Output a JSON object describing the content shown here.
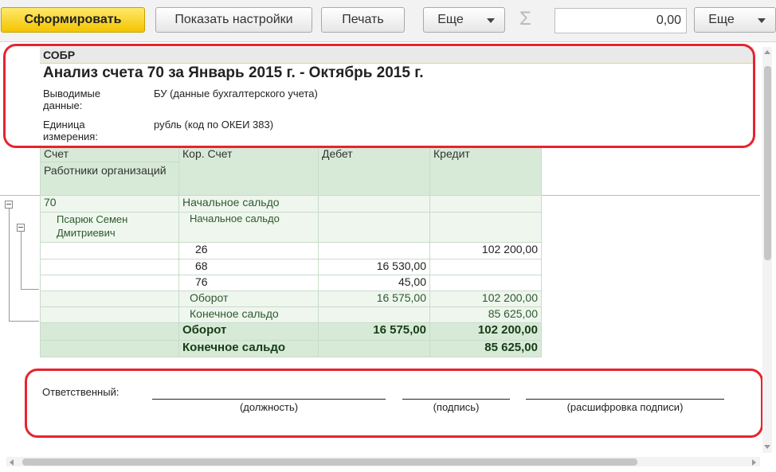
{
  "toolbar": {
    "generate_label": "Сформировать",
    "show_settings_label": "Показать настройки",
    "print_label": "Печать",
    "more_label": "Еще",
    "sum_value": "0,00",
    "more2_label": "Еще"
  },
  "report": {
    "organization": "СОБР",
    "title": "Анализ счета 70 за Январь 2015 г. - Октябрь 2015 г.",
    "params": [
      {
        "label": "Выводимые данные:",
        "value": "БУ (данные бухгалтерского учета)"
      },
      {
        "label": "Единица измерения:",
        "value": "рубль (код по ОКЕИ 383)"
      }
    ],
    "columns": {
      "account": "Счет",
      "account_sub": "Работники организаций",
      "corr_account": "Кор. Счет",
      "debit": "Дебет",
      "credit": "Кредит"
    },
    "rows": [
      {
        "account": "70",
        "corr": "Начальное сальдо",
        "debit": "",
        "credit": ""
      },
      {
        "account": "Псарюк Семен Дмитриевич",
        "corr": "Начальное сальдо",
        "debit": "",
        "credit": ""
      },
      {
        "account": "",
        "corr": "26",
        "debit": "",
        "credit": "102 200,00"
      },
      {
        "account": "",
        "corr": "68",
        "debit": "16 530,00",
        "credit": ""
      },
      {
        "account": "",
        "corr": "76",
        "debit": "45,00",
        "credit": ""
      },
      {
        "account": "",
        "corr": "Оборот",
        "debit": "16 575,00",
        "credit": "102 200,00"
      },
      {
        "account": "",
        "corr": "Конечное сальдо",
        "debit": "",
        "credit": "85 625,00"
      },
      {
        "account": "",
        "corr": "Оборот",
        "debit": "16 575,00",
        "credit": "102 200,00"
      },
      {
        "account": "",
        "corr": "Конечное сальдо",
        "debit": "",
        "credit": "85 625,00"
      }
    ],
    "signature": {
      "label": "Ответственный:",
      "position": "(должность)",
      "sign": "(подпись)",
      "decode": "(расшифровка подписи)"
    }
  },
  "colors": {
    "accent_yellow": "#f3c400",
    "header_green": "#d7ead7",
    "annotation_red": "#e8232f"
  }
}
